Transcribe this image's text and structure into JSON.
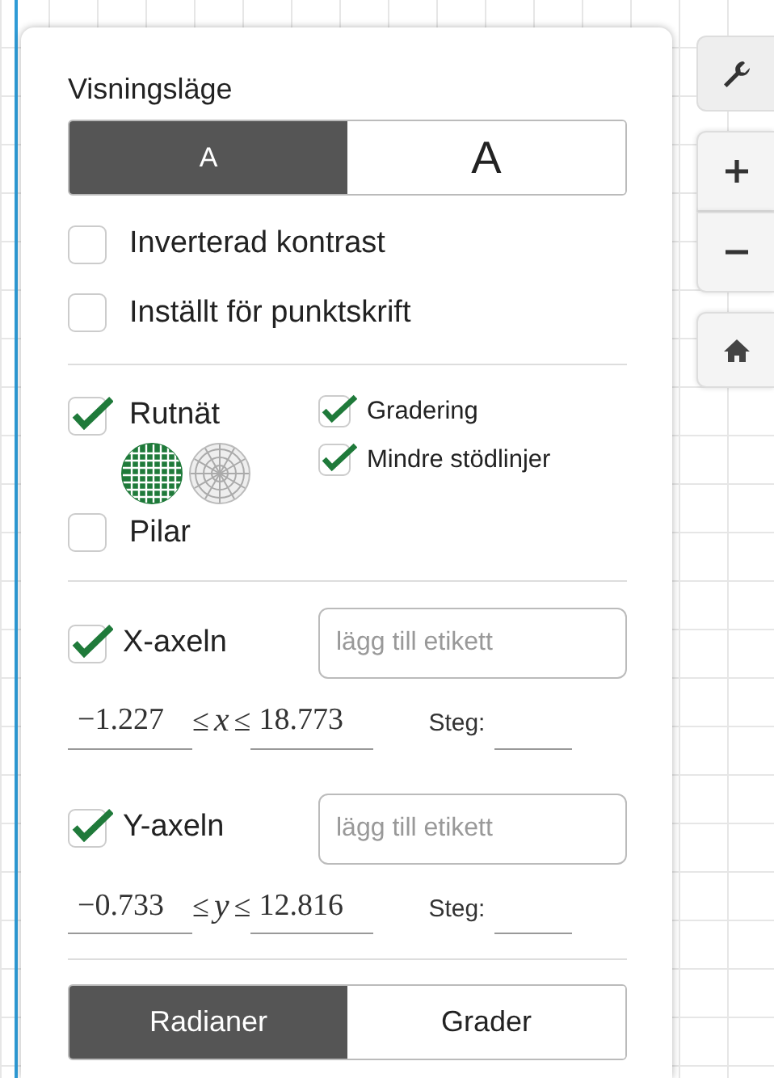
{
  "display_mode": {
    "label": "Visningsläge",
    "options": [
      {
        "label": "A",
        "kind": "small",
        "selected": true
      },
      {
        "label": "A",
        "kind": "large",
        "selected": false
      }
    ]
  },
  "accessibility": [
    {
      "label": "Inverterad kontrast",
      "checked": false
    },
    {
      "label": "Inställt för punktskrift",
      "checked": false
    }
  ],
  "grid": {
    "label": "Rutnät",
    "checked": true,
    "grid_types": [
      {
        "kind": "cartesian",
        "selected": true
      },
      {
        "kind": "polar",
        "selected": false
      }
    ]
  },
  "grid_options": [
    {
      "label": "Gradering",
      "checked": true
    },
    {
      "label": "Mindre stödlinjer",
      "checked": true
    }
  ],
  "arrows": {
    "label": "Pilar",
    "checked": false
  },
  "axes": [
    {
      "label": "X-axeln",
      "checked": true,
      "placeholder": "lägg till etikett",
      "min": "−1.227",
      "relations": [
        "≤",
        "≤"
      ],
      "variable": "x",
      "max": "18.773",
      "step_label": "Steg:"
    },
    {
      "label": "Y-axeln",
      "checked": true,
      "placeholder": "lägg till etikett",
      "min": "−0.733",
      "relations": [
        "≤",
        "≤"
      ],
      "variable": "y",
      "max": "12.816",
      "step_label": "Steg:"
    }
  ],
  "angle_units": [
    {
      "label": "Radianer",
      "selected": true
    },
    {
      "label": "Grader",
      "selected": false
    }
  ],
  "toolbar": [
    {
      "kind": "wrench",
      "selected": true
    },
    {
      "kind": "plus",
      "selected": false
    },
    {
      "kind": "minus",
      "selected": false
    },
    {
      "kind": "home",
      "selected": false
    }
  ]
}
